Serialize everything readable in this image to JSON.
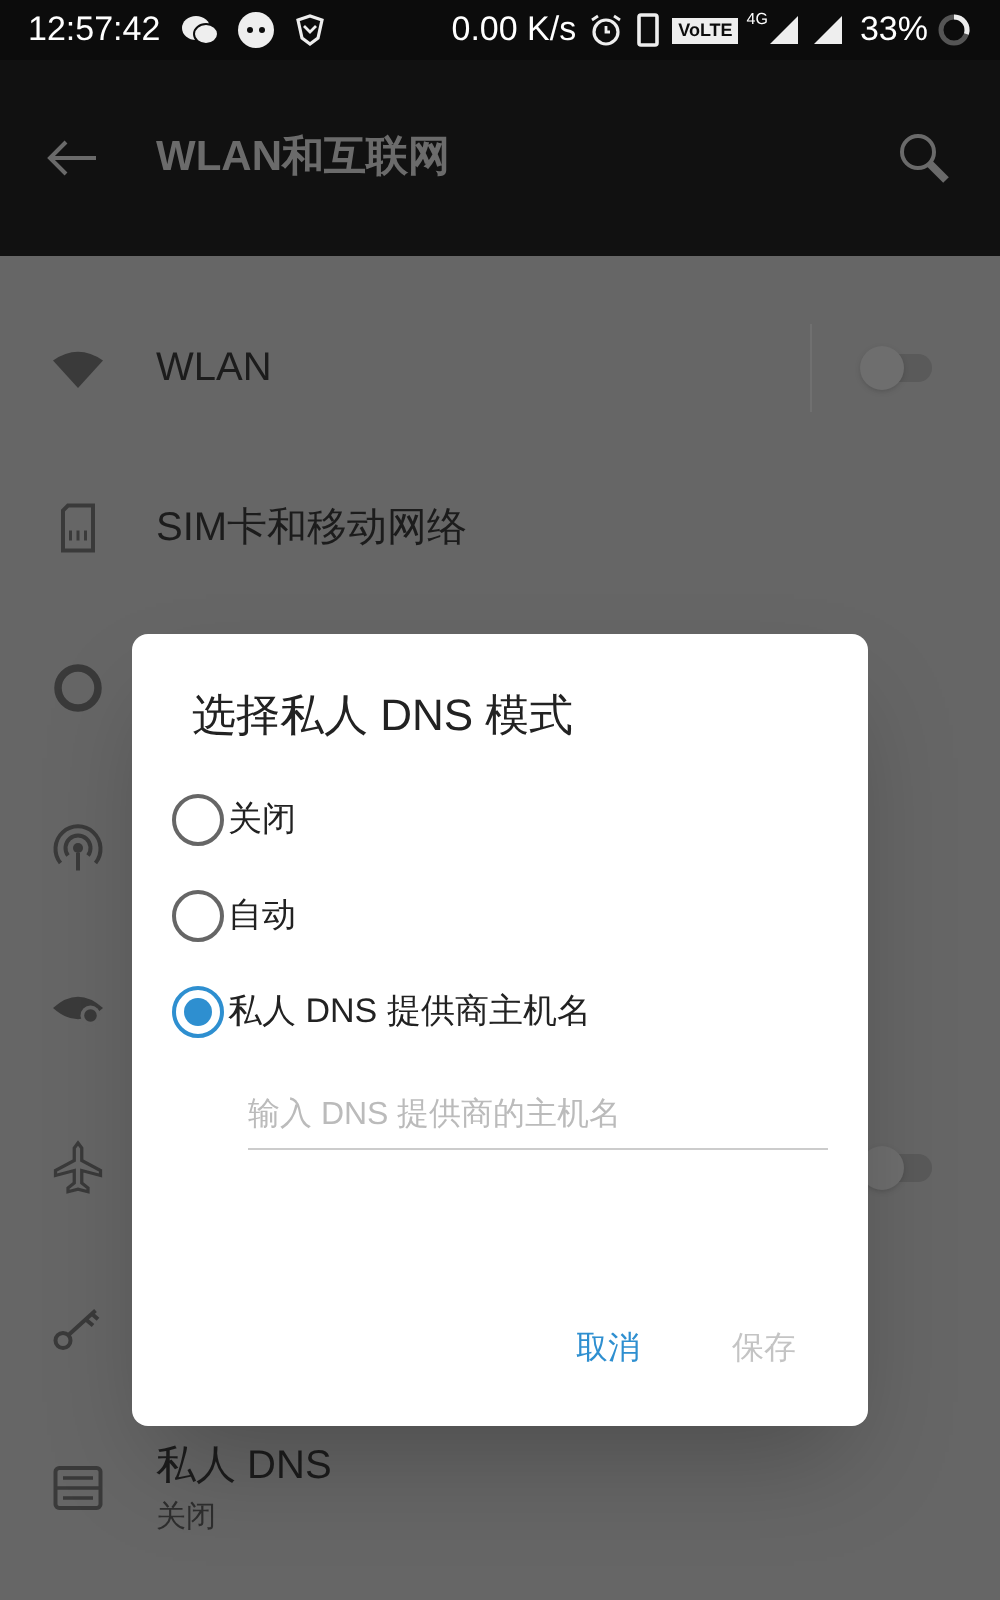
{
  "status_bar": {
    "time": "12:57:42",
    "speed": "0.00 K/s",
    "volte": "VoLTE",
    "network": "4G",
    "battery": "33%"
  },
  "app_bar": {
    "title": "WLAN和互联网"
  },
  "settings": [
    {
      "kind": "wifi",
      "label": "WLAN",
      "toggle": {
        "on": false
      }
    },
    {
      "kind": "sim",
      "label": "SIM卡和移动网络"
    },
    {
      "kind": "ring"
    },
    {
      "kind": "hotspot"
    },
    {
      "kind": "eye"
    },
    {
      "kind": "airplane",
      "toggle": {
        "on": false
      }
    },
    {
      "kind": "key"
    },
    {
      "kind": "dns",
      "label": "私人 DNS",
      "subtitle": "关闭"
    }
  ],
  "dialog": {
    "title": "选择私人 DNS 模式",
    "options": [
      {
        "label": "关闭",
        "selected": false
      },
      {
        "label": "自动",
        "selected": false
      },
      {
        "label": "私人 DNS 提供商主机名",
        "selected": true
      }
    ],
    "hostname_field": {
      "placeholder": "输入 DNS 提供商的主机名"
    },
    "buttons": [
      {
        "label": "取消",
        "disabled": false
      },
      {
        "label": "保存",
        "disabled": true
      }
    ]
  }
}
